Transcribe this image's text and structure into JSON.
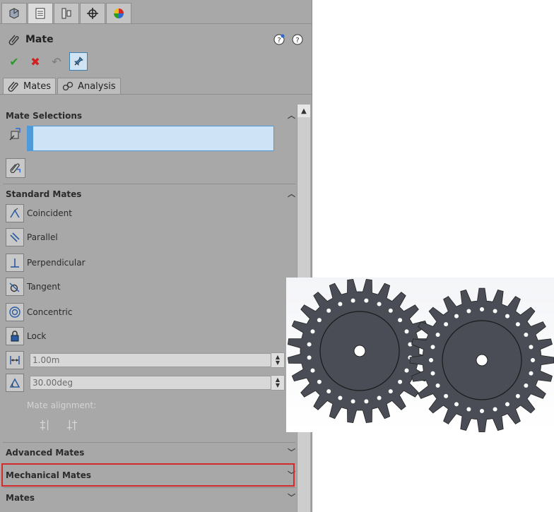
{
  "property_manager": {
    "title": "Mate",
    "sub_tabs": [
      {
        "label": "Mates"
      },
      {
        "label": "Analysis"
      }
    ]
  },
  "sections": {
    "mate_selections": "Mate Selections",
    "standard_mates": "Standard Mates",
    "advanced_mates": "Advanced Mates",
    "mechanical_mates": "Mechanical Mates",
    "mates": "Mates"
  },
  "standard_mates": [
    {
      "label": "Coincident",
      "icon": "coincident-icon"
    },
    {
      "label": "Parallel",
      "icon": "parallel-icon"
    },
    {
      "label": "Perpendicular",
      "icon": "perpendicular-icon"
    },
    {
      "label": "Tangent",
      "icon": "tangent-icon"
    },
    {
      "label": "Concentric",
      "icon": "concentric-icon"
    },
    {
      "label": "Lock",
      "icon": "lock-icon"
    }
  ],
  "distance_value": "1.00m",
  "angle_value": "30.00deg",
  "mate_alignment_label": "Mate alignment:",
  "colors": {
    "panel_bg": "#a8a8a8",
    "selection_highlight": "#4f9ad8",
    "callout_red": "#d22b2b",
    "gear_fill": "#4a4d55"
  }
}
